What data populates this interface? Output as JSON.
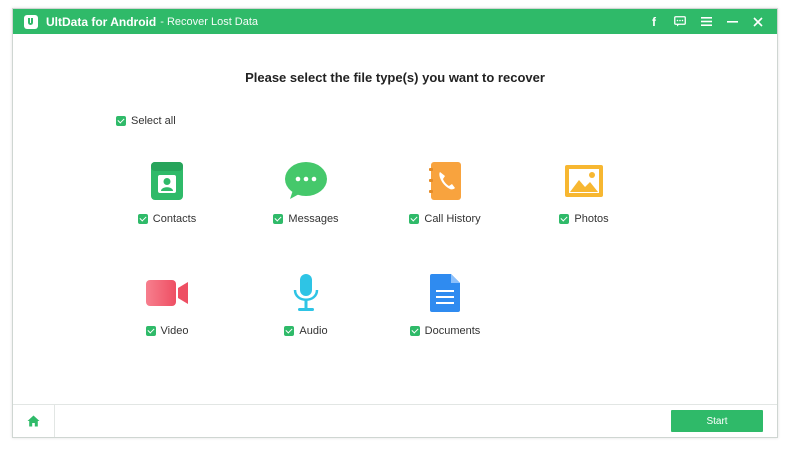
{
  "titlebar": {
    "app_name": "UltData for Android",
    "subtitle": "- Recover Lost Data",
    "controls": {
      "facebook": "f"
    }
  },
  "main": {
    "heading": "Please select the file type(s) you want to recover",
    "select_all_label": "Select all",
    "file_types": [
      {
        "label": "Contacts",
        "icon": "contacts-icon",
        "checked": true,
        "color": "#2fba69"
      },
      {
        "label": "Messages",
        "icon": "messages-icon",
        "checked": true,
        "color": "#45c86b"
      },
      {
        "label": "Call History",
        "icon": "call-history-icon",
        "checked": true,
        "color": "#f8a33e"
      },
      {
        "label": "Photos",
        "icon": "photos-icon",
        "checked": true,
        "color": "#f7b731"
      },
      {
        "label": "Video",
        "icon": "video-icon",
        "checked": true,
        "color": "#f2667a"
      },
      {
        "label": "Audio",
        "icon": "audio-icon",
        "checked": true,
        "color": "#2ec4e5"
      },
      {
        "label": "Documents",
        "icon": "documents-icon",
        "checked": true,
        "color": "#2f8bf0"
      }
    ]
  },
  "footer": {
    "start_label": "Start"
  },
  "colors": {
    "accent": "#2fba69"
  }
}
